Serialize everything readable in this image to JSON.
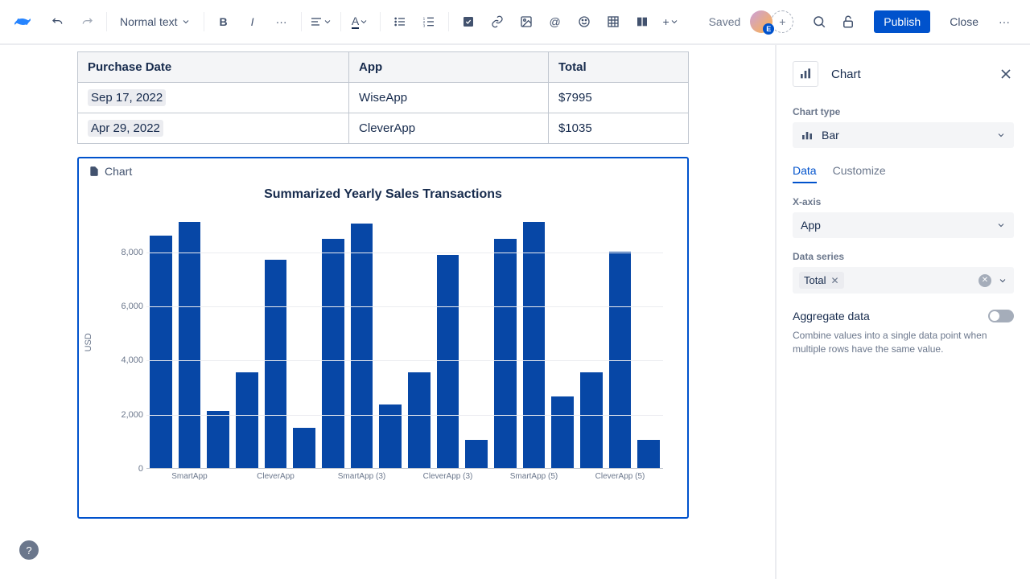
{
  "toolbar": {
    "text_style": "Normal text",
    "saved": "Saved",
    "publish": "Publish",
    "close": "Close"
  },
  "table": {
    "headers": [
      "Purchase Date",
      "App",
      "Total"
    ],
    "rows": [
      {
        "date": "Sep 17, 2022",
        "app": "WiseApp",
        "total": "$7995"
      },
      {
        "date": "Apr 29, 2022",
        "app": "CleverApp",
        "total": "$1035"
      }
    ]
  },
  "chart_block": {
    "label": "Chart"
  },
  "chart_data": {
    "type": "bar",
    "title": "Summarized Yearly Sales Transactions",
    "ylabel": "USD",
    "ylim": [
      0,
      9500
    ],
    "yticks": [
      0,
      2000,
      4000,
      6000,
      8000
    ],
    "ytick_labels": [
      "0",
      "2,000",
      "4,000",
      "6,000",
      "8,000"
    ],
    "categories": [
      "SmartApp",
      "",
      "CleverApp",
      "",
      "SmartApp (3)",
      "",
      "CleverApp (3)",
      "",
      "SmartApp (5)",
      "",
      "CleverApp (5)",
      ""
    ],
    "values": [
      8600,
      9100,
      2100,
      3550,
      7700,
      1500,
      8500,
      9050,
      2350,
      3550,
      7900,
      1050,
      8500,
      9100,
      2650,
      3550,
      8000,
      1050
    ]
  },
  "panel": {
    "title": "Chart",
    "chart_type_label": "Chart type",
    "chart_type_value": "Bar",
    "tabs": {
      "data": "Data",
      "customize": "Customize"
    },
    "xaxis_label": "X-axis",
    "xaxis_value": "App",
    "data_series_label": "Data series",
    "data_series_tag": "Total",
    "aggregate_label": "Aggregate data",
    "aggregate_help": "Combine values into a single data point when multiple rows have the same value."
  }
}
